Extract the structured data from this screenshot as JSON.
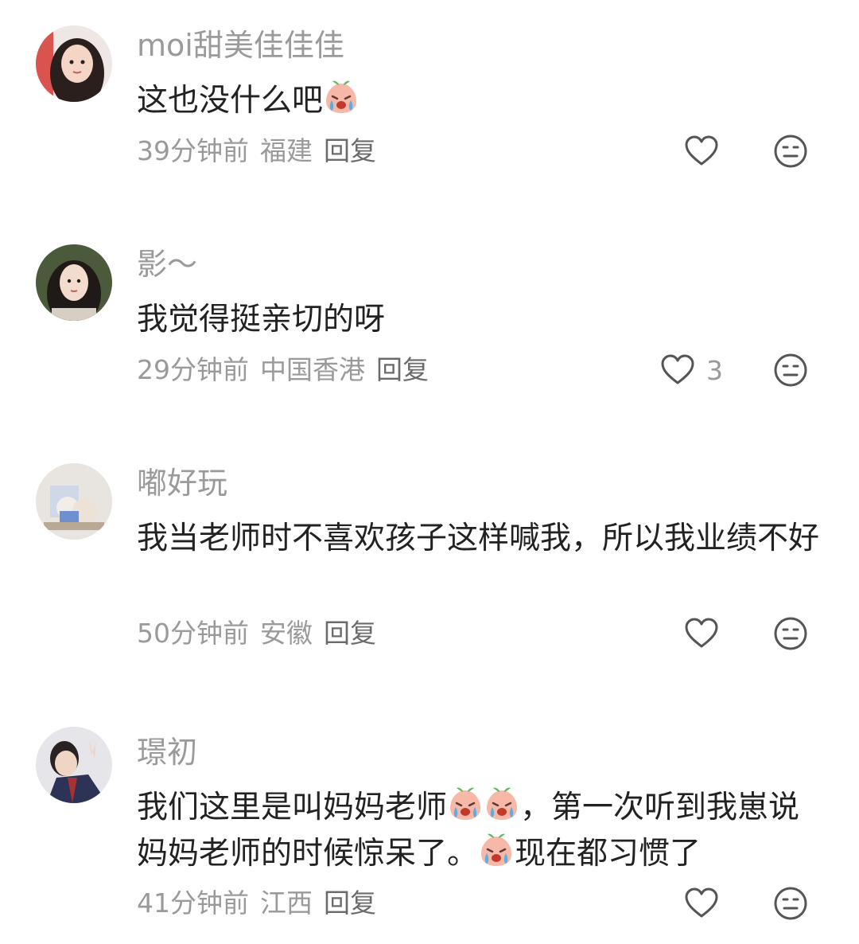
{
  "comments": [
    {
      "username": "moi甜美佳佳佳",
      "text_parts": [
        "这也没什么吧"
      ],
      "time": "39分钟前",
      "location": "福建",
      "reply_label": "回复",
      "like_count": ""
    },
    {
      "username": "影～",
      "text_parts": [
        "我觉得挺亲切的呀"
      ],
      "time": "29分钟前",
      "location": "中国香港",
      "reply_label": "回复",
      "like_count": "3"
    },
    {
      "username": "嘟好玩",
      "text_parts": [
        "我当老师时不喜欢孩子这样喊我，所以我业绩不好"
      ],
      "time": "50分钟前",
      "location": "安徽",
      "reply_label": "回复",
      "like_count": ""
    },
    {
      "username": "璟初",
      "text_parts": [
        "我们这里是叫妈妈老师",
        "，第一次听到我崽说妈妈老师的时候惊呆了。",
        "现在都习惯了"
      ],
      "time": "41分钟前",
      "location": "江西",
      "reply_label": "回复",
      "like_count": ""
    }
  ],
  "icons": {
    "like": "heart-outline-icon",
    "dislike": "meh-face-icon",
    "emoji": "crying-peach-emoji"
  },
  "colors": {
    "username": "#9a9a9a",
    "text": "#222222",
    "meta": "#9a9a9a",
    "reply": "#6b6b6b",
    "icon": "#555555"
  }
}
